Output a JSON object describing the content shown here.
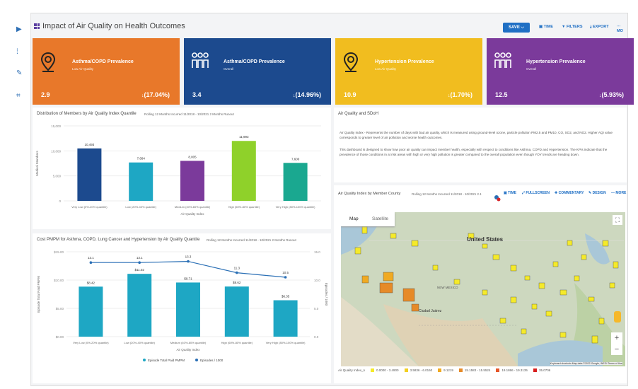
{
  "header": {
    "title": "Impact of Air Quality on Health Outcomes",
    "save": "SAVE ⌵",
    "time": "TIME",
    "filters": "FILTERS",
    "export": "EXPORT",
    "more": "⋯ MO"
  },
  "cards": [
    {
      "title": "Asthma/COPD Prevalence",
      "subtitle": "Low Air Quality",
      "value": "2.9",
      "pct": "(17.04%)",
      "color": "#e8782a",
      "icon": "location-pin-icon"
    },
    {
      "title": "Asthma/COPD Prevalence",
      "subtitle": "Overall",
      "value": "3.4",
      "pct": "(14.96%)",
      "color": "#1c4a8e",
      "icon": "people-group-icon"
    },
    {
      "title": "Hypertension Prevalence",
      "subtitle": "Low Air Quality",
      "value": "10.9",
      "pct": "(1.70%)",
      "color": "#f1bd1f",
      "icon": "location-pin-icon"
    },
    {
      "title": "Hypertension Prevalence",
      "subtitle": "Overall",
      "value": "12.5",
      "pct": "(5.93%)",
      "color": "#7b3a9b",
      "icon": "people-group-icon"
    }
  ],
  "chart1": {
    "title": "Distribution of Members by Air Quality Index Quantile",
    "subtitle": "Rolling 12 Months Incurred 11/2018 - 10/2021 2 Months Runout"
  },
  "chart2": {
    "title": "Cost PMPM for Asthma, COPD, Lung Cancer and Hypertension by Air Quality Quantile",
    "subtitle": "Rolling 12 Months Incurred 11/2018 - 10/2021 2 Months Runout"
  },
  "sdoh": {
    "title": "Air Quality and SDoH",
    "p1": "Air Quality Index - Represents the number of days with bad air quality, which is measured using ground-level ozone, particle pollution PM2.5 and PM10, CO, SO2, and NO2. Higher AQI value corresponds to greater level of air pollution and worse health outcomes.",
    "p2": "This dashboard is designed to show how poor air quality can impact member health, especially with respect to conditions like Asthma, COPD and Hypertension. The KPIs indicate that the prevalence of those conditions in at risk areas with high or very high pollution is greater compared to the overall population even though YOY trends are heading down."
  },
  "map": {
    "title": "Air Quality Index by Member County",
    "subtitle": "Rolling 12 Months Incurred 11/2018 - 10/2021 2.1",
    "time": "TIME",
    "fullscreen": "FULLSCREEN",
    "commentary": "COMMENTARY",
    "design": "DESIGN",
    "more": "— MORE",
    "tab_map": "Map",
    "tab_sat": "Satellite",
    "country": "United States",
    "city1": "Ciudad Juárez",
    "city2": "NEW MEXICO",
    "footer": "Keyboard shortcuts   Map data ©2022 Google, INEGI   Terms of Use",
    "legend_title": "Air Quality Index_n",
    "legend": [
      [
        "0.0000 - 3.4900",
        "#f5ea2a"
      ],
      [
        "3.5836 - 6.0160",
        "#f2cf22"
      ],
      [
        "9.1219",
        "#f0aa22"
      ],
      [
        "15.1583 - 15.5524",
        "#e68a28"
      ],
      [
        "19.1866 - 19.3135",
        "#e5562a"
      ],
      [
        "35.0706",
        "#d81e1e"
      ]
    ]
  },
  "chart_data": [
    {
      "type": "bar",
      "title": "Distribution of Members by Air Quality Index Quantile",
      "ylabel": "Medical Members",
      "xlabel": "Air Quality Index",
      "ylim": [
        0,
        15000
      ],
      "yticks": [
        "15,000",
        "10,000",
        "5,000",
        "0"
      ],
      "categories": [
        "Very Low (0%-20% quantile)",
        "Low (20%-40% quantile)",
        "Medium (40%-60% quantile)",
        "High (60%-80% quantile)",
        "Very High (80%-100% quantile)"
      ],
      "values": [
        10493,
        7684,
        8005,
        11993,
        7600
      ],
      "labels": [
        "10,493",
        "7,684",
        "8,005",
        "11,993",
        "7,600"
      ],
      "colors": [
        "#1c4a8e",
        "#1ea7c4",
        "#7b3a9b",
        "#8fd12a",
        "#1aa890"
      ]
    },
    {
      "type": "bar",
      "title": "Cost PMPM for Asthma, COPD, Lung Cancer and Hypertension by Air Quality Quantile",
      "ylabel": "Episode Total Paid PMPM",
      "ylabel2": "Episodes / 1000",
      "xlabel": "Air Quality Index",
      "ylim": [
        0,
        150
      ],
      "y2lim": [
        0,
        15
      ],
      "yticks": [
        "$15.00",
        "$10.00",
        "$5.00",
        "$0.00"
      ],
      "yticks2": [
        "15.0",
        "10.0",
        "5.0",
        "0.0"
      ],
      "categories": [
        "Very Low (0%-20% quantile)",
        "Low (20%-40% quantile)",
        "Medium (40%-60% quantile)",
        "High (60%-80% quantile)",
        "Very High (80%-100% quantile)"
      ],
      "series": [
        {
          "name": "Episode Total Paid PMPM",
          "values": [
            88.42,
            111.02,
            95.71,
            88.62,
            64.35
          ],
          "labels": [
            "$8.42",
            "$11.02",
            "$9.71",
            "$8.62",
            "$6.35"
          ],
          "color": "#1ea7c4"
        },
        {
          "name": "Episodes / 1000",
          "values": [
            13.1,
            13.1,
            13.3,
            11.3,
            10.5
          ],
          "labels": [
            "13.1",
            "13.1",
            "13.3",
            "11.3",
            "10.5"
          ],
          "color": "#2a6fb5"
        }
      ]
    }
  ]
}
